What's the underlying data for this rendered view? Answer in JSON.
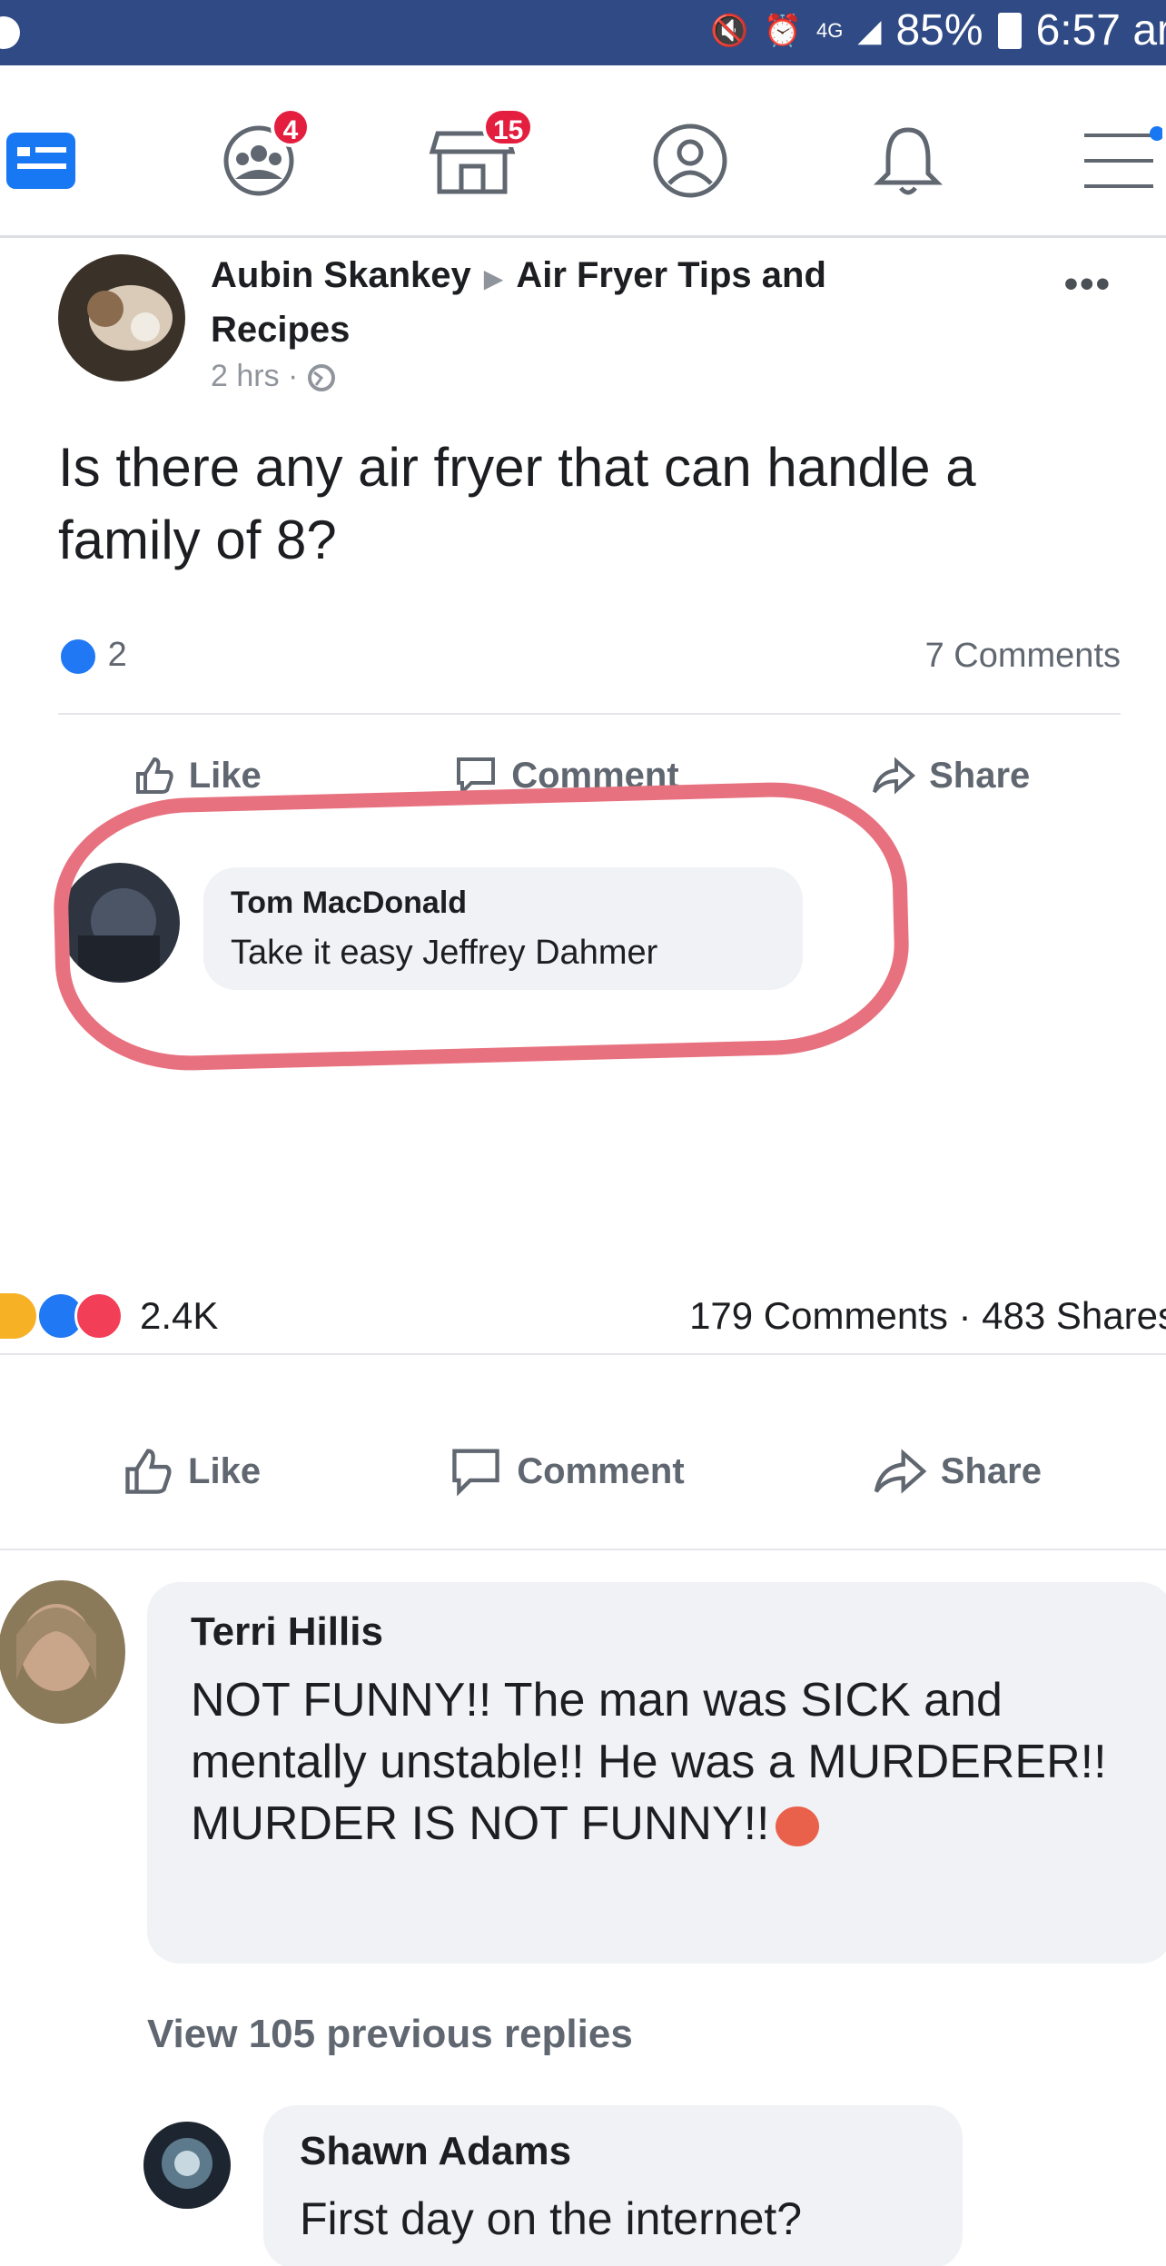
{
  "status_bar": {
    "network": "4G",
    "battery": "85%",
    "time": "6:57 ar"
  },
  "nav": {
    "groups_badge": "4",
    "marketplace_badge": "15"
  },
  "colors": {
    "status_bar_bg": "#2f4a84",
    "accent_blue": "#2078f4",
    "badge_red": "#e41e3f",
    "highlight_pink": "#e8717f"
  },
  "shared_post": {
    "author": "Aubin Skankey",
    "group": "Air Fryer Tips and Recipes",
    "time": "2 hrs ·",
    "text": "Is there any air fryer that can handle a family of 8?",
    "reactions_count": "2",
    "comments_count": "7 Comments",
    "actions": {
      "like": "Like",
      "comment": "Comment",
      "share": "Share"
    },
    "top_comment": {
      "name": "Tom MacDonald",
      "text": "Take it easy Jeffrey Dahmer"
    }
  },
  "outer_post": {
    "reactions_count": "2.4K",
    "comments_shares": "179 Comments · 483 Shares",
    "actions": {
      "like": "Like",
      "comment": "Comment",
      "share": "Share"
    }
  },
  "comments": [
    {
      "name": "Terri Hillis",
      "text": "NOT FUNNY!! The man was SICK and mentally unstable!! He was a MURDERER!! MURDER IS NOT FUNNY!!"
    },
    {
      "name": "Shawn Adams",
      "text": "First day on the internet?"
    }
  ],
  "view_replies": "View 105 previous replies"
}
